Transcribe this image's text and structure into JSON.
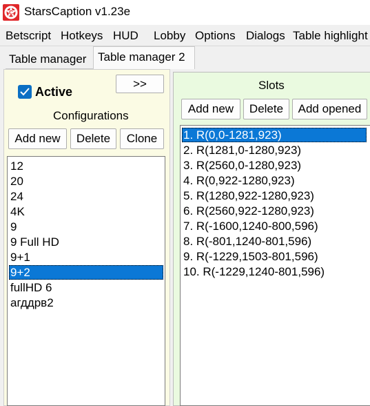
{
  "window": {
    "title": "StarsCaption v1.23e"
  },
  "menu_tabs": [
    "Betscript",
    "Hotkeys",
    "HUD",
    "Lobby",
    "Options",
    "Dialogs",
    "Table highlight"
  ],
  "sub_tabs": [
    {
      "label": "Table manager",
      "active": false
    },
    {
      "label": "Table manager 2",
      "active": true
    }
  ],
  "left_panel": {
    "active_label": "Active",
    "active_checked": true,
    "toggle_label": ">>",
    "configurations_title": "Configurations",
    "buttons": {
      "add_new": "Add new",
      "delete": "Delete",
      "clone": "Clone"
    },
    "configurations": [
      "12",
      "20",
      "24",
      "4K",
      "9",
      "9 Full HD",
      "9+1",
      "9+2",
      "fullHD 6",
      "агддрв2"
    ],
    "selected_index": 7
  },
  "right_panel": {
    "slots_title": "Slots",
    "buttons": {
      "add_new": "Add new",
      "delete": "Delete",
      "add_opened": "Add opened"
    },
    "slots": [
      "1. R(0,0-1281,923)",
      "2. R(1281,0-1280,923)",
      "3. R(2560,0-1280,923)",
      "4. R(0,922-1280,923)",
      "5. R(1280,922-1280,923)",
      "6. R(2560,922-1280,923)",
      "7. R(-1600,1240-800,596)",
      "8. R(-801,1240-801,596)",
      "9. R(-1229,1503-801,596)",
      "10. R(-1229,1240-801,596)"
    ],
    "selected_index": 0
  },
  "colors": {
    "selection": "#0b78d6",
    "left_panel_bg": "#fbfbe4",
    "right_panel_bg": "#eafae0",
    "app_icon_red": "#e0282b"
  },
  "icons": {
    "app": "stars-caption-logo-icon",
    "checkbox": "checkmark-icon"
  }
}
